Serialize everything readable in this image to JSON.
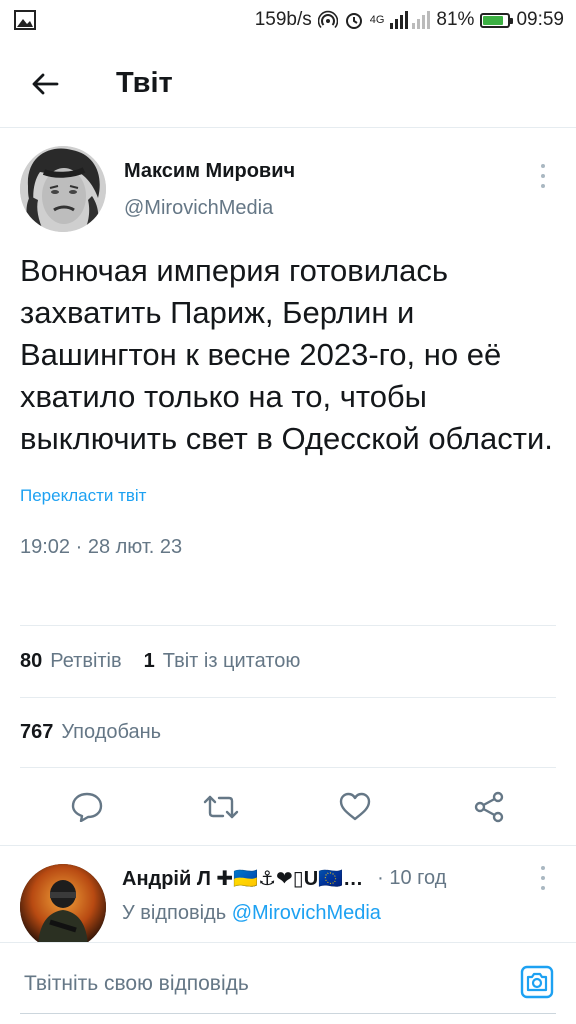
{
  "status_bar": {
    "network_speed": "159b/s",
    "network_type": "4G",
    "battery_percent": "81%",
    "battery_level": 0.81,
    "time": "09:59",
    "icons": [
      "image-icon",
      "hotspot-icon",
      "alarm-icon",
      "signal-icon",
      "battery-icon"
    ]
  },
  "header": {
    "title": "Твіт",
    "back_icon": "arrow-left-icon"
  },
  "tweet": {
    "author_name": "Максим Мирович",
    "author_handle": "@MirovichMedia",
    "text": "Вонючая империя готовилась захватить Париж, Берлин и Вашингтон к весне 2023-го, но её хватило только на то, чтобы выключить свет в Одесской области.",
    "translate_label": "Перекласти твіт",
    "timestamp": "19:02 · 28 лют. 23"
  },
  "stats": {
    "retweets_count": "80",
    "retweets_label": "Ретвітів",
    "quotes_count": "1",
    "quotes_label": "Твіт із цитатою",
    "likes_count": "767",
    "likes_label": "Уподобань"
  },
  "actions": [
    "reply-icon",
    "retweet-icon",
    "like-icon",
    "share-icon"
  ],
  "reply": {
    "author_name": "Андрій Л ✚🇺🇦⚓❤▯U🇪🇺…",
    "time": "· 10 год",
    "reply_to_prefix": "У відповідь",
    "reply_to_handle": "@MirovichMedia"
  },
  "composer": {
    "placeholder": "Твітніть свою відповідь"
  },
  "colors": {
    "accent": "#1da1f2",
    "text": "#14171a",
    "secondary": "#657786",
    "divider": "#e6ecf0",
    "battery": "#3cb043"
  }
}
